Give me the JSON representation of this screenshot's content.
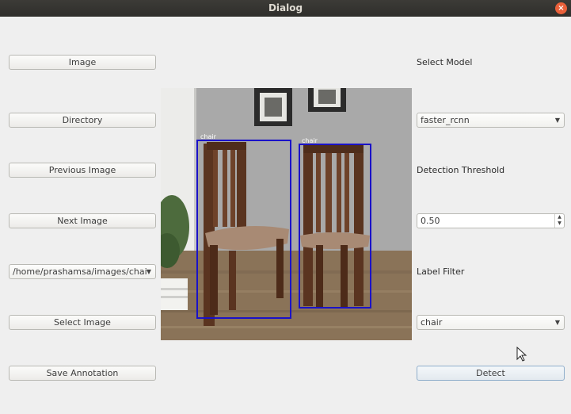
{
  "window": {
    "title": "Dialog",
    "close_glyph": "×"
  },
  "left": {
    "image_label": "Image",
    "directory_label": "Directory",
    "previous_label": "Previous Image",
    "next_label": "Next Image",
    "path_value": "/home/prashamsa/images/chai",
    "select_image_label": "Select Image",
    "save_label": "Save Annotation"
  },
  "right": {
    "select_model_label": "Select Model",
    "model_value": "faster_rcnn",
    "threshold_label": "Detection Threshold",
    "threshold_value": "0.50",
    "label_filter_label": "Label Filter",
    "label_filter_value": "chair",
    "detect_label": "Detect"
  },
  "detections": [
    {
      "label": "chair"
    },
    {
      "label": "chair"
    }
  ],
  "colors": {
    "box": "#1a12c8",
    "titlebar": "#3c3b37",
    "close": "#e9603a"
  },
  "icons": {
    "dropdown": "chevron-down-icon",
    "spin": "spin-arrows-icon",
    "cursor": "mouse-pointer-icon"
  }
}
